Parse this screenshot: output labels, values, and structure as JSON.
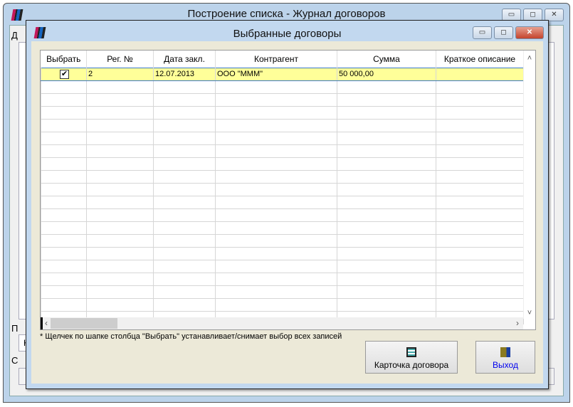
{
  "main_window": {
    "title": "Построение списка - Журнал договоров",
    "partial_labels": [
      "Д",
      "П",
      "К",
      "С"
    ]
  },
  "dialog": {
    "title": "Выбранные договоры",
    "columns": [
      "Выбрать",
      "Рег. №",
      "Дата закл.",
      "Контрагент",
      "Сумма",
      "Краткое описание"
    ],
    "rows": [
      {
        "selected": true,
        "reg_no": "2",
        "date": "12.07.2013",
        "counterparty": "ООО \"МММ\"",
        "sum": "50 000,00",
        "description": ""
      }
    ],
    "note": "* Щелчек по шапке столбца \"Выбрать\" устанавливает/снимает выбор всех записей",
    "card_button": "Карточка договора",
    "exit_button": "Выход",
    "check_mark": "✔"
  },
  "colors": {
    "selected_row": "#ffff99",
    "exit_text": "#0000ee"
  }
}
